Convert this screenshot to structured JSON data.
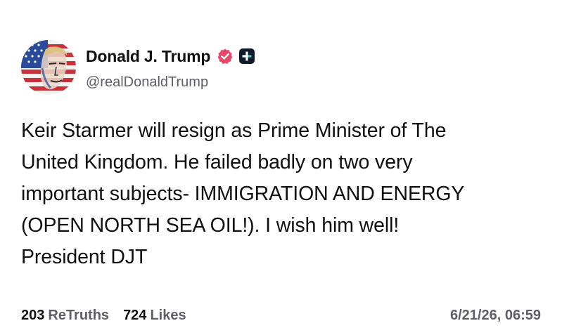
{
  "author": {
    "display_name": "Donald J. Trump",
    "handle": "@realDonaldTrump",
    "avatar": "flag-portrait-avatar",
    "verified_icon": "verified-badge-icon",
    "plus_icon": "plus-badge-icon"
  },
  "post": {
    "lines": [
      "Keir Starmer will resign as Prime Minister of The",
      "United Kingdom. He failed badly on two very",
      "important subjects- IMMIGRATION AND ENERGY",
      "(OPEN NORTH SEA OIL!). I wish him well!",
      "President DJT"
    ]
  },
  "stats": {
    "retruths_count": "203",
    "retruths_label": "ReTruths",
    "likes_count": "724",
    "likes_label": "Likes"
  },
  "timestamp": "6/21/26, 06:59",
  "colors": {
    "text": "#0f0f14",
    "muted": "#5e5e6a",
    "verified": "#e8476a",
    "plus_badge": "#0f1b2d"
  }
}
